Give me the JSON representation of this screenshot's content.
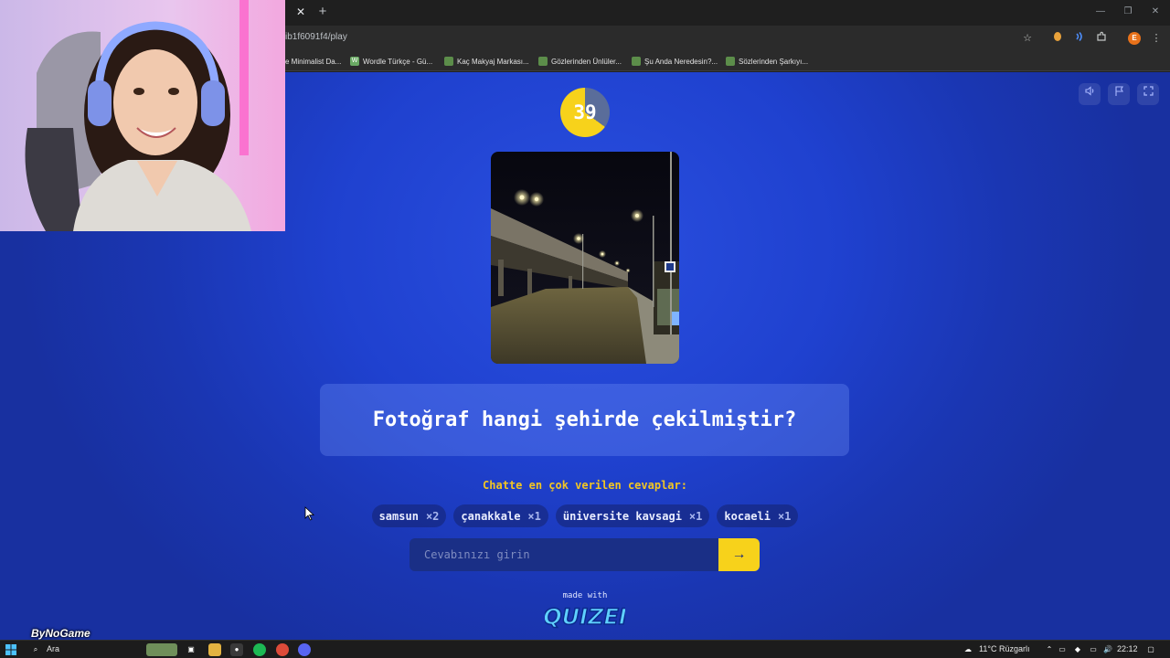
{
  "browser": {
    "url": "ib1f6091f4/play",
    "tab_close": "✕",
    "tab_new": "+",
    "win_min": "—",
    "win_max": "❐",
    "win_close": "✕",
    "profile_initial": "E",
    "bookmarks": [
      {
        "label": "e Minimalist Da...",
        "icon": "",
        "color": "#2b2b2b"
      },
      {
        "label": "Wordle Türkçe - Gü...",
        "icon": "W",
        "color": "#6aaa64"
      },
      {
        "label": "Kaç Makyaj Markası...",
        "icon": "",
        "color": "#4a7a4a"
      },
      {
        "label": "Gözlerinden Ünlüler...",
        "icon": "",
        "color": "#4a7a4a"
      },
      {
        "label": "Şu Anda Neredesin?...",
        "icon": "",
        "color": "#4a7a4a"
      },
      {
        "label": "Sözlerinden Şarkıyı...",
        "icon": "",
        "color": "#4a7a4a"
      }
    ],
    "icons": [
      "star-icon",
      "extension-orange-icon",
      "extension-sound-icon",
      "extensions-puzzle-icon",
      "profile-avatar",
      "menu-kebab-icon"
    ]
  },
  "game": {
    "timer": {
      "value": "39",
      "remaining_fraction": 0.65
    },
    "question": "Fotoğraf hangi şehirde çekilmiştir?",
    "chat_label": "Chatte en çok verilen cevaplar:",
    "answers": [
      {
        "text": "samsun",
        "count": "×2"
      },
      {
        "text": "çanakkale",
        "count": "×1"
      },
      {
        "text": "üniversite kavsagi",
        "count": "×1"
      },
      {
        "text": "kocaeli",
        "count": "×1"
      }
    ],
    "input_placeholder": "Cevabınızı girin",
    "submit_label": "→",
    "made_with": "made with",
    "logo_text": "QUIZEI",
    "tools": [
      "sound-icon",
      "flag-icon",
      "fullscreen-icon"
    ]
  },
  "taskbar": {
    "search_label": "Ara",
    "weather": "11°C Rüzgarlı",
    "time": "22:12"
  },
  "overlay": {
    "watermark": "ByNoGame"
  },
  "colors": {
    "accent_yellow": "#f7d21b",
    "page_blue": "#1f41cf",
    "chip_bg": "#14236e"
  }
}
